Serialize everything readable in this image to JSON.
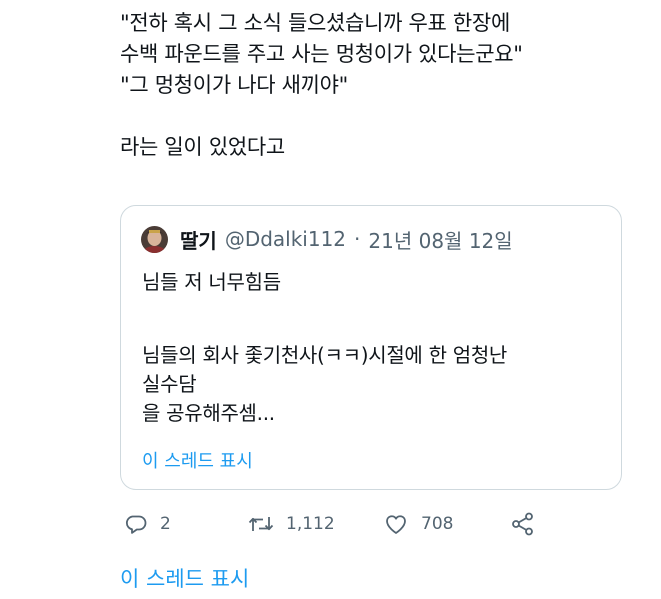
{
  "tweet": {
    "lines": [
      "\"전하 혹시 그 소식 들으셨습니까 우표 한장에",
      "수백 파운드를 주고 사는 멍청이가 있다는군요\"",
      "\"그 멍청이가 나다 새끼야\"",
      "",
      "라는 일이 있었다고"
    ]
  },
  "quote": {
    "name": "딸기",
    "handle": "@Ddalki112",
    "separator": "·",
    "date": "21년 08월 12일",
    "lines": [
      "님들 저 너무힘듬",
      "",
      "님들의 회사 좇기천사(ㅋㅋ)시절에 한 엄청난",
      "실수담",
      "을 공유해주셈..."
    ],
    "show_thread": "이 스레드 표시"
  },
  "actions": {
    "reply": {
      "icon": "reply-icon",
      "count": "2"
    },
    "retweet": {
      "icon": "retweet-icon",
      "count": "1,112"
    },
    "like": {
      "icon": "heart-icon",
      "count": "708"
    },
    "share": {
      "icon": "share-icon"
    }
  },
  "show_thread": "이 스레드 표시",
  "colors": {
    "text": "#0f1419",
    "muted": "#536471",
    "link": "#1d9bf0",
    "border": "#cfd9de"
  }
}
